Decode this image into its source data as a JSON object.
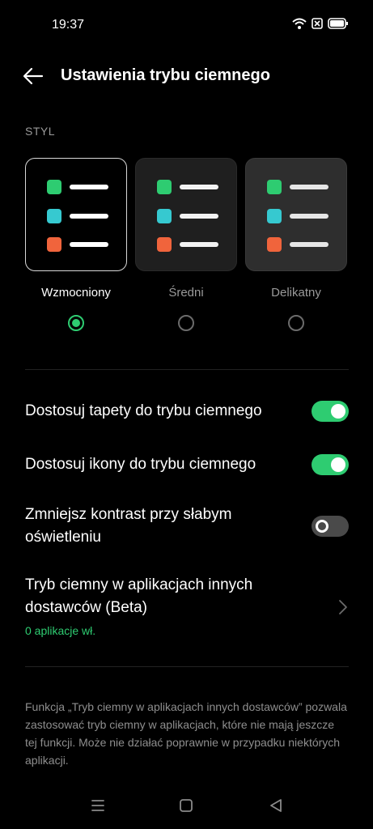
{
  "status_bar": {
    "time": "19:37"
  },
  "header": {
    "title": "Ustawienia trybu ciemnego"
  },
  "style_section": {
    "label": "STYL",
    "options": [
      {
        "label": "Wzmocniony",
        "selected": true
      },
      {
        "label": "Średni",
        "selected": false
      },
      {
        "label": "Delikatny",
        "selected": false
      }
    ],
    "dot_colors": [
      "#2ecc71",
      "#36c9d0",
      "#f0643c"
    ]
  },
  "settings": {
    "wallpaper": {
      "label": "Dostosuj tapety do trybu ciemnego",
      "enabled": true
    },
    "icons": {
      "label": "Dostosuj ikony do trybu ciemnego",
      "enabled": true
    },
    "contrast": {
      "label": "Zmniejsz kontrast przy słabym oświetleniu",
      "enabled": false
    },
    "third_party": {
      "label": "Tryb ciemny w aplikacjach innych dostawców (Beta)",
      "status": "0 aplikacje wł."
    }
  },
  "footnote": "Funkcja „Tryb ciemny w aplikacjach innych dostawców” pozwala zastosować tryb ciemny w aplikacjach, które nie mają jeszcze tej funkcji. Może nie działać poprawnie w przypadku niektórych aplikacji.",
  "colors": {
    "accent": "#2ecc71",
    "background": "#000000"
  }
}
